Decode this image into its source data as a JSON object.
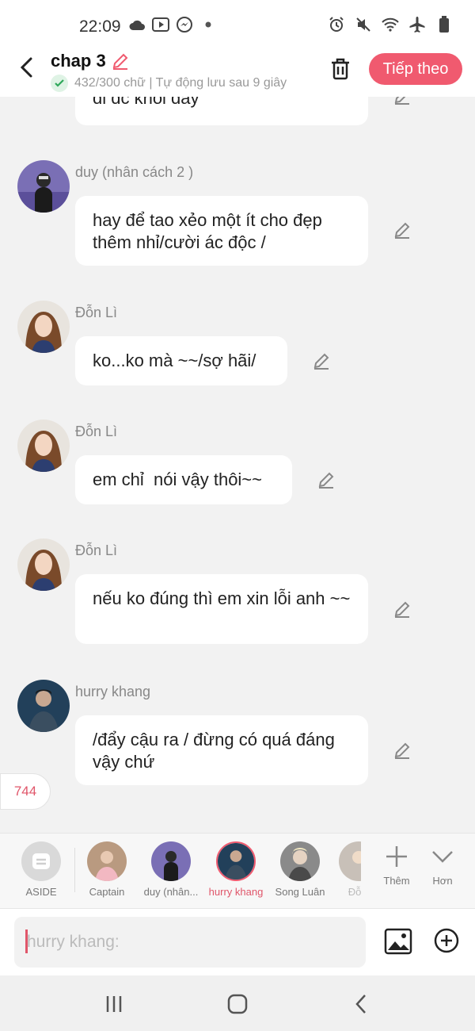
{
  "status_bar": {
    "time": "22:09"
  },
  "header": {
    "title": "chap 3",
    "subtitle": "432/300 chữ | Tự động lưu sau 9 giây",
    "next_label": "Tiếp theo"
  },
  "messages": [
    {
      "sender": "",
      "text": "đi đc khối đấy",
      "avatar": ""
    },
    {
      "sender": "duy (nhân cách 2 )",
      "text": "hay để tao xẻo một ít cho đẹp thêm nhỉ/cười ác độc /",
      "avatar": "avatar-duy"
    },
    {
      "sender": "Đỗn Lì",
      "text": "ko...ko mà ~~/sợ hãi/",
      "avatar": "avatar-don-li"
    },
    {
      "sender": "Đỗn Lì",
      "text": "em chỉ  nói vậy thôi~~",
      "avatar": "avatar-don-li"
    },
    {
      "sender": "Đỗn Lì",
      "text": "nếu ko đúng thì em xin lỗi anh ~~",
      "avatar": "avatar-don-li"
    },
    {
      "sender": "hurry khang",
      "text": "/đẩy cậu ra / đừng có quá đáng vậy chứ",
      "avatar": "avatar-hurry-khang"
    }
  ],
  "counter": "744",
  "characters": [
    {
      "label": "ASIDE",
      "active": false
    },
    {
      "label": "Captain",
      "active": false
    },
    {
      "label": "duy (nhân...",
      "active": false
    },
    {
      "label": "hurry khang",
      "active": true
    },
    {
      "label": "Song Luân",
      "active": false
    },
    {
      "label": "Đỗ",
      "active": false
    }
  ],
  "more": {
    "add_label": "Thêm",
    "expand_label": "Hơn"
  },
  "input": {
    "placeholder": "hurry khang:"
  },
  "colors": {
    "accent": "#f05a6f",
    "bubble": "#ffffff",
    "background": "#f2f2f2"
  }
}
